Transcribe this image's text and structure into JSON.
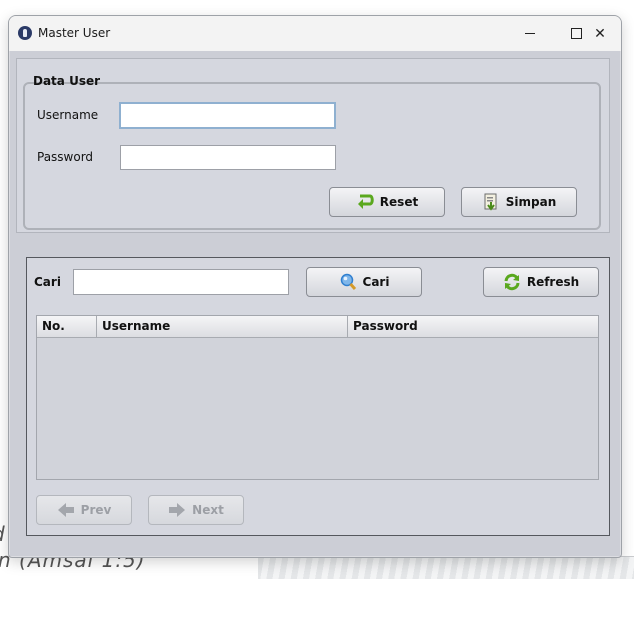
{
  "window": {
    "title": "Master User",
    "controls": {
      "minimize": "minimize",
      "maximize": "maximize",
      "close": "✕"
    }
  },
  "data_user": {
    "title": "Data User",
    "username_label": "Username",
    "username_value": "",
    "password_label": "Password",
    "password_value": "",
    "reset_label": "Reset",
    "save_label": "Simpan"
  },
  "search": {
    "label": "Cari",
    "input_value": "",
    "search_button_label": "Cari",
    "refresh_button_label": "Refresh"
  },
  "table": {
    "columns": [
      "No.",
      "Username",
      "Password"
    ],
    "rows": []
  },
  "pagination": {
    "prev_label": "Prev",
    "next_label": "Next",
    "prev_enabled": false,
    "next_enabled": false
  },
  "background": {
    "line1": "d",
    "line2": "n (Amsal 1:5)"
  },
  "icons": {
    "app": "app-icon",
    "reset": "reset-arrow-icon",
    "save": "save-document-icon",
    "search": "magnifier-icon",
    "refresh": "refresh-icon",
    "prev": "left-arrow-icon",
    "next": "right-arrow-icon"
  },
  "colors": {
    "reset_icon": "#5aa81e",
    "refresh_icon": "#5aa81e",
    "search_icon": "#2f7fd0",
    "focus_border": "#8fb0d0"
  }
}
